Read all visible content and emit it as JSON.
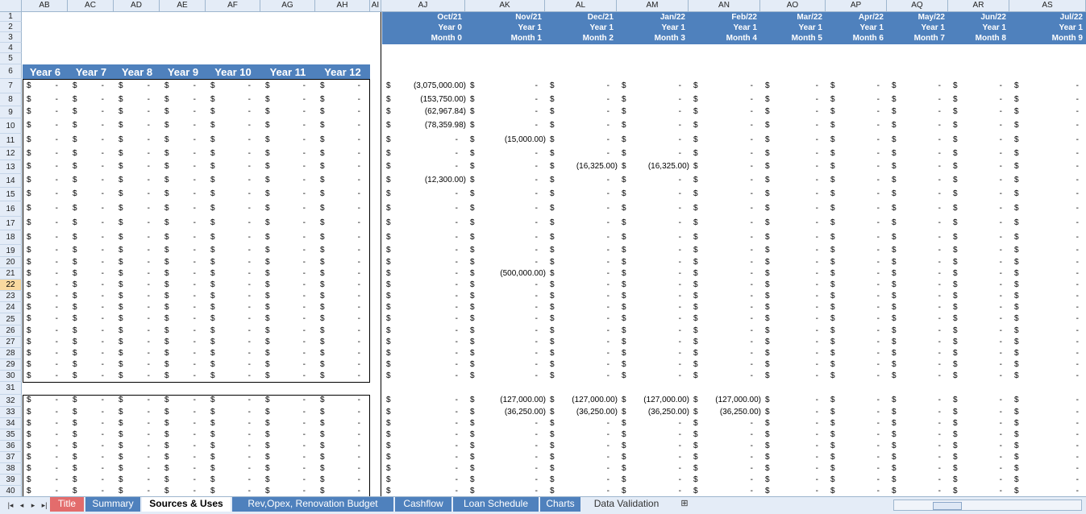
{
  "window": {
    "title": "Sources & Uses"
  },
  "columns": [
    {
      "id": "AB"
    },
    {
      "id": "AC"
    },
    {
      "id": "AD"
    },
    {
      "id": "AE"
    },
    {
      "id": "AF"
    },
    {
      "id": "AG"
    },
    {
      "id": "AH"
    },
    {
      "id": "AI"
    },
    {
      "id": "AJ"
    },
    {
      "id": "AK"
    },
    {
      "id": "AL"
    },
    {
      "id": "AM"
    },
    {
      "id": "AN"
    },
    {
      "id": "AO"
    },
    {
      "id": "AP"
    },
    {
      "id": "AQ"
    },
    {
      "id": "AR"
    },
    {
      "id": "AS"
    }
  ],
  "rows": [
    "1",
    "2",
    "3",
    "4",
    "5",
    "6",
    "7",
    "8",
    "9",
    "10",
    "11",
    "12",
    "13",
    "14",
    "15",
    "16",
    "17",
    "18",
    "19",
    "20",
    "21",
    "22",
    "23",
    "24",
    "25",
    "26",
    "27",
    "28",
    "29",
    "30",
    "31",
    "32",
    "33",
    "34",
    "35",
    "36",
    "37",
    "38",
    "39",
    "40"
  ],
  "selected_row": "22",
  "year_headers": [
    "Year 6",
    "Year 7",
    "Year 8",
    "Year 9",
    "Year 10",
    "Year 11",
    "Year 12"
  ],
  "month_headers": [
    {
      "date": "Oct/21",
      "year": "Year 0",
      "month": "Month 0"
    },
    {
      "date": "Nov/21",
      "year": "Year 1",
      "month": "Month 1"
    },
    {
      "date": "Dec/21",
      "year": "Year 1",
      "month": "Month 2"
    },
    {
      "date": "Jan/22",
      "year": "Year 1",
      "month": "Month 3"
    },
    {
      "date": "Feb/22",
      "year": "Year 1",
      "month": "Month 4"
    },
    {
      "date": "Mar/22",
      "year": "Year 1",
      "month": "Month 5"
    },
    {
      "date": "Apr/22",
      "year": "Year 1",
      "month": "Month 6"
    },
    {
      "date": "May/22",
      "year": "Year 1",
      "month": "Month 7"
    },
    {
      "date": "Jun/22",
      "year": "Year 1",
      "month": "Month 8"
    },
    {
      "date": "Jul/22",
      "year": "Year 1",
      "month": "Month 9"
    }
  ],
  "currency_symbol": "$",
  "dash": "-",
  "values": {
    "7": {
      "AJ": "(3,075,000.00)"
    },
    "8": {
      "AJ": "(153,750.00)"
    },
    "9": {
      "AJ": "(62,967.84)"
    },
    "10": {
      "AJ": "(78,359.98)"
    },
    "11": {
      "AK": "(15,000.00)"
    },
    "13": {
      "AL": "(16,325.00)",
      "AM": "(16,325.00)"
    },
    "14": {
      "AJ": "(12,300.00)"
    },
    "21": {
      "AK": "(500,000.00)"
    },
    "32": {
      "AK": "(127,000.00)",
      "AL": "(127,000.00)",
      "AM": "(127,000.00)",
      "AN": "(127,000.00)"
    },
    "33": {
      "AK": "(36,250.00)",
      "AL": "(36,250.00)",
      "AM": "(36,250.00)",
      "AN": "(36,250.00)"
    }
  },
  "sheet_tabs": [
    {
      "label": "Title",
      "style": "red"
    },
    {
      "label": "Summary",
      "style": "blue"
    },
    {
      "label": "Sources & Uses",
      "style": "active"
    },
    {
      "label": "Rev,Opex, Renovation Budget",
      "style": "blue"
    },
    {
      "label": "Cashflow",
      "style": "blue"
    },
    {
      "label": "Loan Schedule",
      "style": "blue"
    },
    {
      "label": "Charts",
      "style": "blue"
    },
    {
      "label": "Data Validation",
      "style": "plain"
    }
  ],
  "colors": {
    "header_band": "#4f81bd",
    "tab_red": "#e36c6c",
    "selected_row": "#f9d99f",
    "grid_header": "#e4ecf7"
  }
}
